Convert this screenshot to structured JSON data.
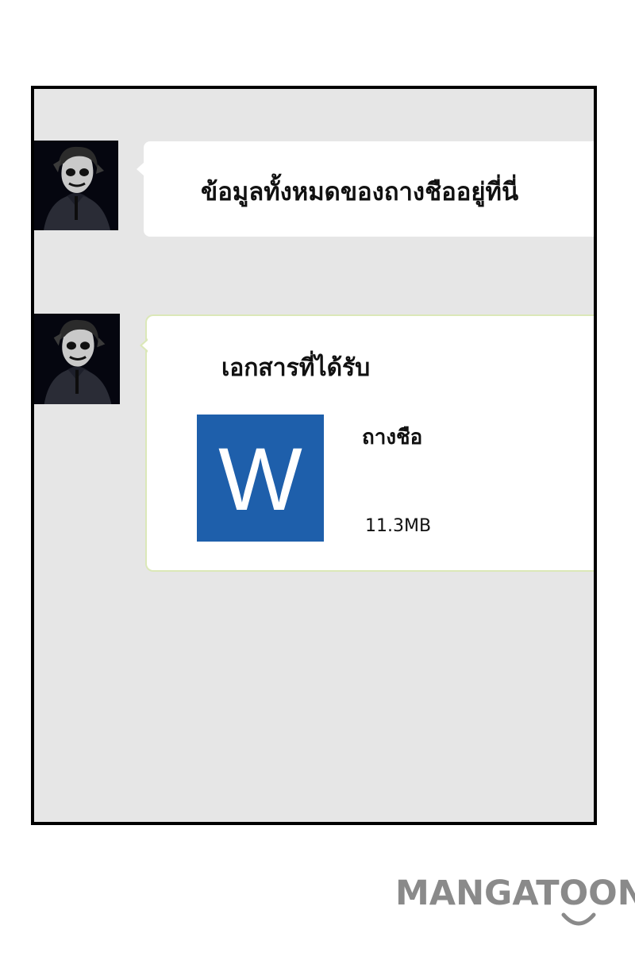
{
  "chat": {
    "messages": [
      {
        "avatar": "joker-avatar",
        "text": "ข้อมูลทั้งหมดของถางชืออยู่ที่นี่"
      },
      {
        "avatar": "joker-avatar",
        "heading": "เอกสารที่ได้รับ",
        "file": {
          "icon_letter": "W",
          "icon_name": "word-document-icon",
          "name": "ถางชือ",
          "size": "11.3MB"
        }
      }
    ]
  },
  "watermark": {
    "text": "MANGATOON"
  },
  "colors": {
    "panel_background": "#e6e6e6",
    "bubble_background": "#ffffff",
    "word_blue": "#1e5fab",
    "watermark_gray": "#8a8a8a",
    "bubble_border_green": "#dbe8b8"
  }
}
